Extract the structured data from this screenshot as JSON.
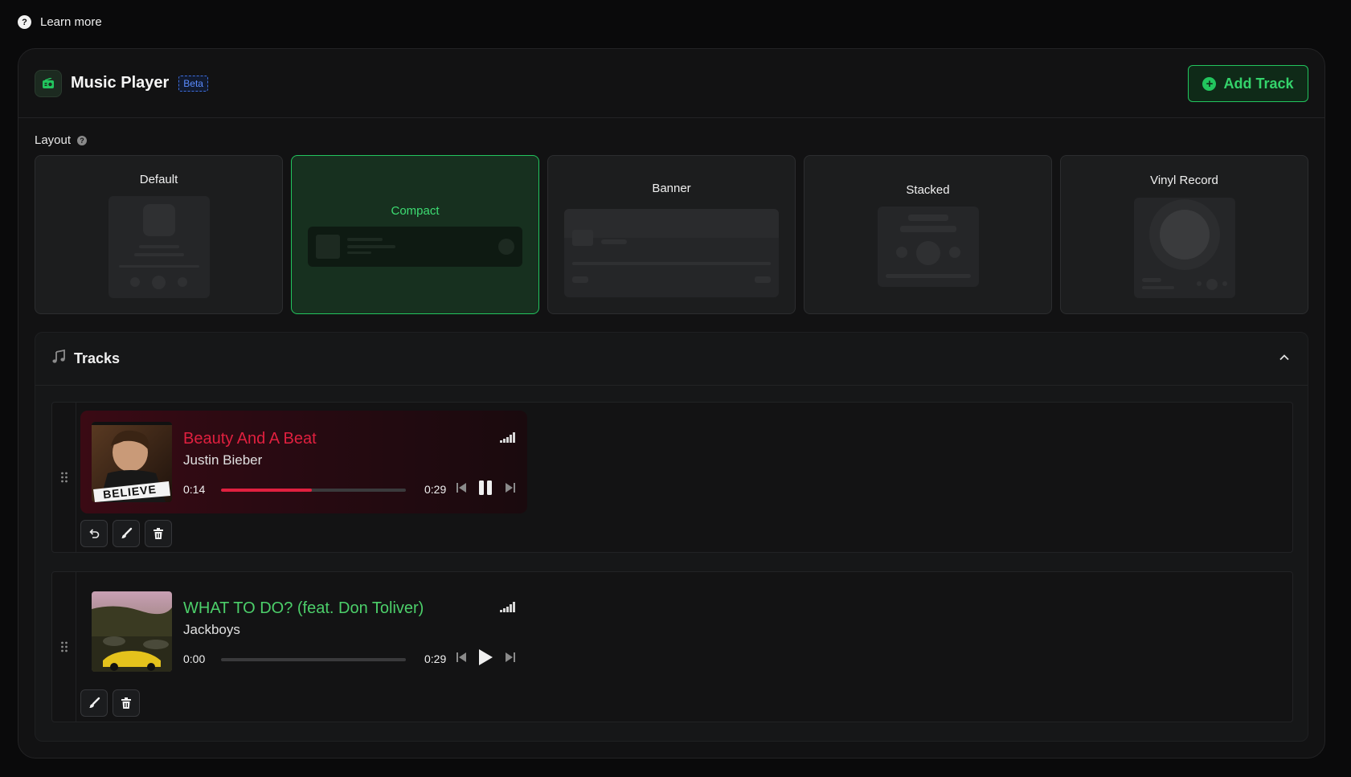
{
  "learn_more": {
    "label": "Learn more"
  },
  "header": {
    "title": "Music Player",
    "badge": "Beta",
    "add_track_label": "Add Track"
  },
  "layout": {
    "label": "Layout",
    "options": [
      {
        "label": "Default",
        "selected": false
      },
      {
        "label": "Compact",
        "selected": true
      },
      {
        "label": "Banner",
        "selected": false
      },
      {
        "label": "Stacked",
        "selected": false
      },
      {
        "label": "Vinyl Record",
        "selected": false
      }
    ]
  },
  "tracks": {
    "title": "Tracks",
    "items": [
      {
        "title": "Beauty And A Beat",
        "artist": "Justin Bieber",
        "current_time": "0:14",
        "duration": "0:29",
        "progress": 0.49,
        "playing": true,
        "accent": "#e0203f",
        "cover_text": "BELIEVE",
        "actions": [
          "undo-icon",
          "brush-icon",
          "trash-icon"
        ]
      },
      {
        "title": "WHAT TO DO? (feat. Don Toliver)",
        "artist": "Jackboys",
        "current_time": "0:00",
        "duration": "0:29",
        "progress": 0,
        "playing": false,
        "accent": "#4ccf6a",
        "actions": [
          "brush-icon",
          "trash-icon"
        ]
      }
    ]
  }
}
